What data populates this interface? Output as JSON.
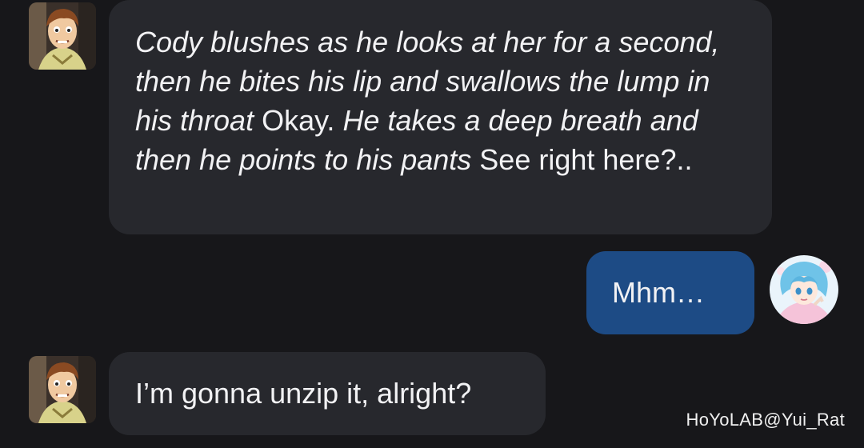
{
  "messages": [
    {
      "side": "incoming",
      "segments": [
        {
          "style": "italic",
          "text": "Cody blushes as he looks at her for a second, then he bites his lip and swallows the lump in his throat"
        },
        {
          "style": "normal",
          "text": " Okay. "
        },
        {
          "style": "italic",
          "text": "He takes a deep breath and then he points to his pants"
        },
        {
          "style": "normal",
          "text": " See right here?.."
        }
      ]
    },
    {
      "side": "outgoing",
      "text": "Mhm…"
    },
    {
      "side": "incoming",
      "text": "I’m gonna unzip it, alright?"
    }
  ],
  "watermark": "HoYoLAB@Yui_Rat",
  "colors": {
    "background": "#17171a",
    "incoming_bubble": "#27282d",
    "outgoing_bubble": "#1d4b85",
    "text": "#f2f2f4"
  },
  "icons": {
    "bot_avatar": "cartoon-boy-avatar",
    "user_avatar": "anime-girl-avatar"
  }
}
